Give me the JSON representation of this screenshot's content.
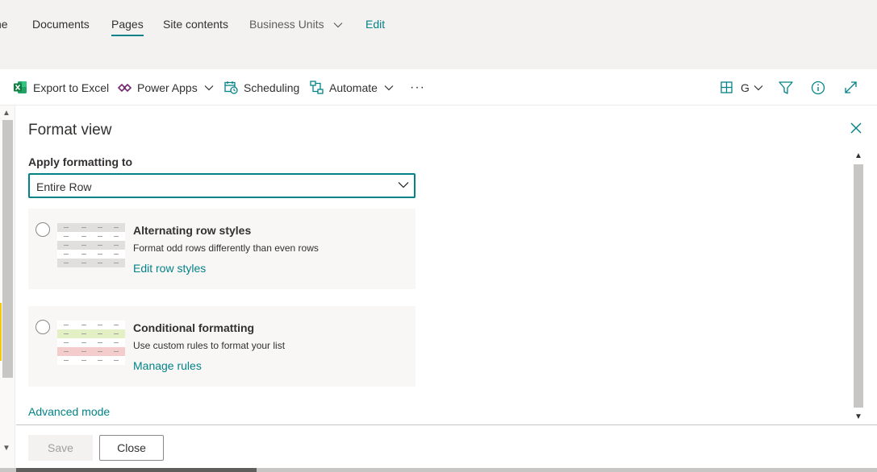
{
  "nav": {
    "items": [
      {
        "label": "ne"
      },
      {
        "label": "Documents"
      },
      {
        "label": "Pages"
      },
      {
        "label": "Site contents"
      },
      {
        "label": "Business Units"
      },
      {
        "label": "Edit"
      }
    ]
  },
  "commandbar": {
    "export_label": "Export to Excel",
    "powerapps_label": "Power Apps",
    "scheduling_label": "Scheduling",
    "automate_label": "Automate",
    "more_label": "···",
    "view_label": "G"
  },
  "panel": {
    "title": "Format view",
    "apply_label": "Apply formatting to",
    "dropdown_value": "Entire Row",
    "options": [
      {
        "title": "Alternating row styles",
        "description": "Format odd rows differently than even rows",
        "link": "Edit row styles"
      },
      {
        "title": "Conditional formatting",
        "description": "Use custom rules to format your list",
        "link": "Manage rules"
      }
    ],
    "advanced_mode": "Advanced mode",
    "save_label": "Save",
    "close_label": "Close"
  },
  "colors": {
    "accent": "#038387",
    "excel": "#107c41",
    "rule_green": "#e3f0c4",
    "rule_red": "#f4cccc"
  },
  "icons": [
    "excel-icon",
    "power-apps-icon",
    "scheduling-icon",
    "automate-icon",
    "view-grid-icon",
    "filter-icon",
    "info-icon",
    "expand-icon",
    "close-icon",
    "chevron-down-icon"
  ]
}
